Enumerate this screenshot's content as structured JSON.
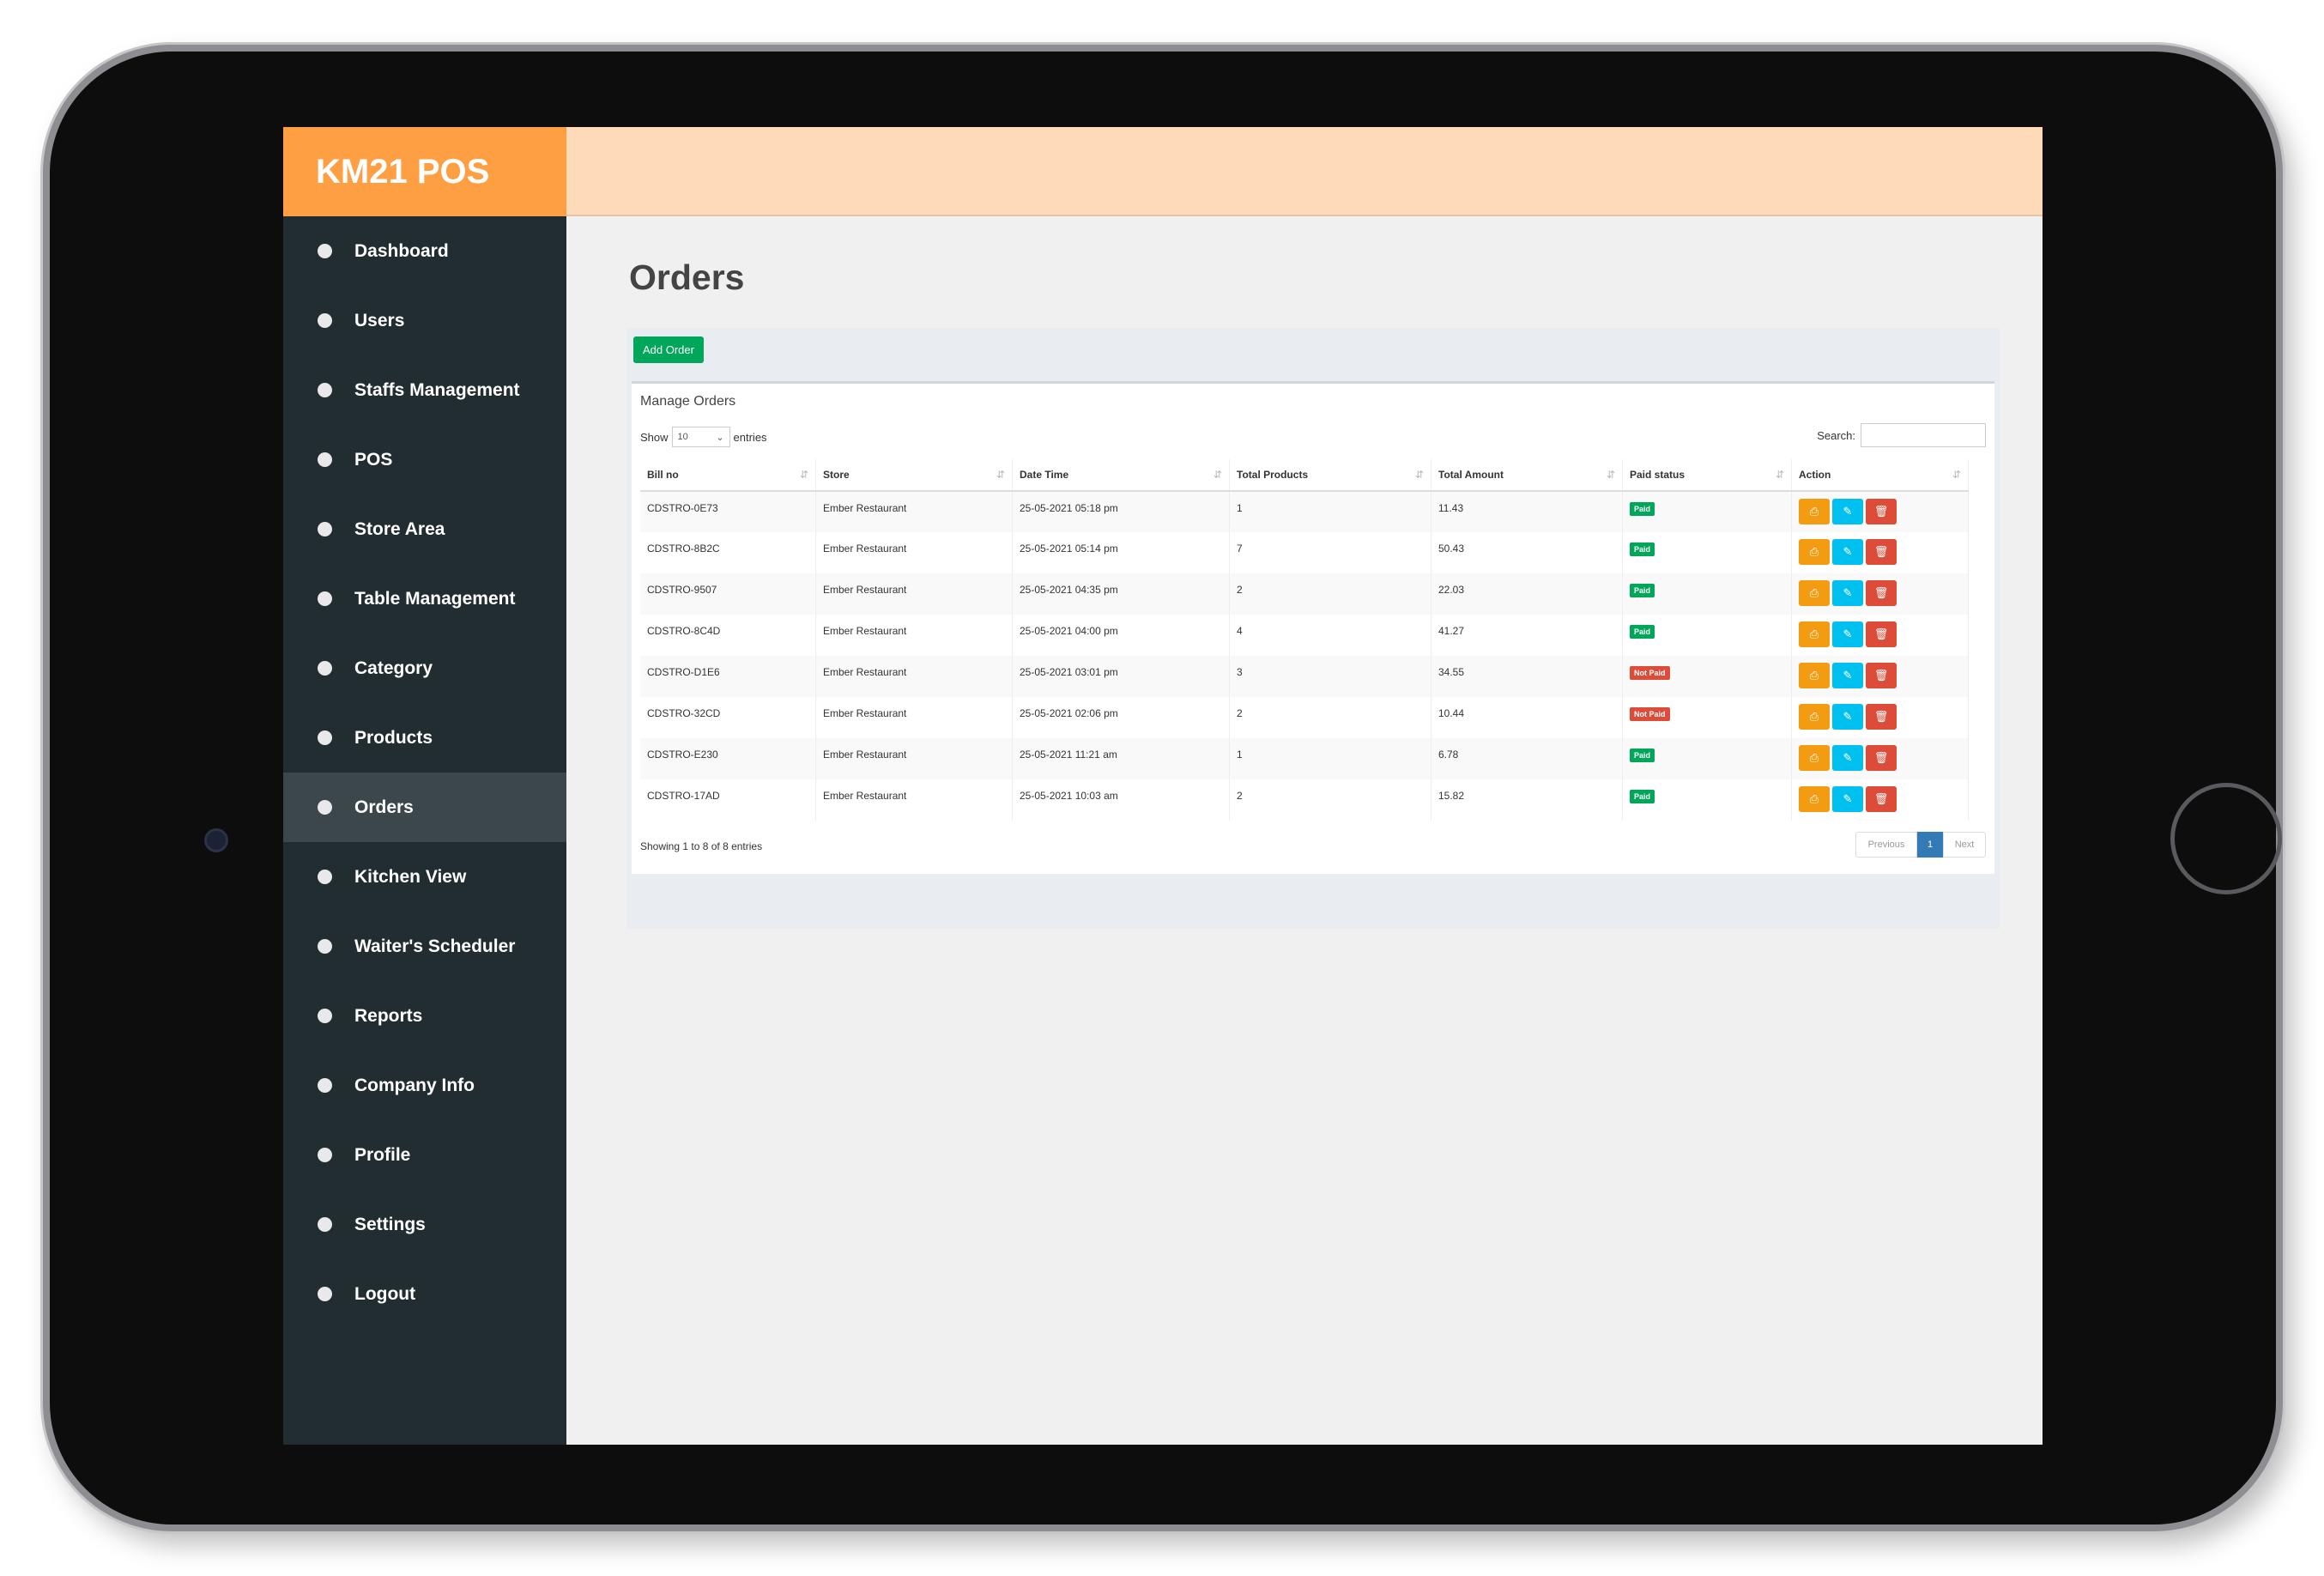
{
  "brand": {
    "title": "KM21 POS"
  },
  "sidebar": {
    "items": [
      {
        "label": "Dashboard"
      },
      {
        "label": "Users"
      },
      {
        "label": "Staffs Management"
      },
      {
        "label": "POS"
      },
      {
        "label": "Store Area"
      },
      {
        "label": "Table Management"
      },
      {
        "label": "Category"
      },
      {
        "label": "Products"
      },
      {
        "label": "Orders",
        "active": true
      },
      {
        "label": "Kitchen View"
      },
      {
        "label": "Waiter's Scheduler"
      },
      {
        "label": "Reports"
      },
      {
        "label": "Company Info"
      },
      {
        "label": "Profile"
      },
      {
        "label": "Settings"
      },
      {
        "label": "Logout"
      }
    ]
  },
  "page": {
    "title": "Orders",
    "add_button": "Add Order",
    "card_title": "Manage Orders",
    "show_label": "Show",
    "entries_label": "entries",
    "page_length": "10",
    "search_label": "Search:",
    "info": "Showing 1 to 8 of 8 entries"
  },
  "table": {
    "columns": [
      "Bill no",
      "Store",
      "Date Time",
      "Total Products",
      "Total Amount",
      "Paid status",
      "Action"
    ],
    "rows": [
      {
        "bill": "CDSTRO-0E73",
        "store": "Ember Restaurant",
        "datetime": "25-05-2021 05:18 pm",
        "products": "1",
        "amount": "11.43",
        "status": "Paid"
      },
      {
        "bill": "CDSTRO-8B2C",
        "store": "Ember Restaurant",
        "datetime": "25-05-2021 05:14 pm",
        "products": "7",
        "amount": "50.43",
        "status": "Paid"
      },
      {
        "bill": "CDSTRO-9507",
        "store": "Ember Restaurant",
        "datetime": "25-05-2021 04:35 pm",
        "products": "2",
        "amount": "22.03",
        "status": "Paid"
      },
      {
        "bill": "CDSTRO-8C4D",
        "store": "Ember Restaurant",
        "datetime": "25-05-2021 04:00 pm",
        "products": "4",
        "amount": "41.27",
        "status": "Paid"
      },
      {
        "bill": "CDSTRO-D1E6",
        "store": "Ember Restaurant",
        "datetime": "25-05-2021 03:01 pm",
        "products": "3",
        "amount": "34.55",
        "status": "Not Paid"
      },
      {
        "bill": "CDSTRO-32CD",
        "store": "Ember Restaurant",
        "datetime": "25-05-2021 02:06 pm",
        "products": "2",
        "amount": "10.44",
        "status": "Not Paid"
      },
      {
        "bill": "CDSTRO-E230",
        "store": "Ember Restaurant",
        "datetime": "25-05-2021 11:21 am",
        "products": "1",
        "amount": "6.78",
        "status": "Paid"
      },
      {
        "bill": "CDSTRO-17AD",
        "store": "Ember Restaurant",
        "datetime": "25-05-2021 10:03 am",
        "products": "2",
        "amount": "15.82",
        "status": "Paid"
      }
    ]
  },
  "pagination": {
    "previous": "Previous",
    "current": "1",
    "next": "Next"
  },
  "colors": {
    "brand": "#ff9f43",
    "topbar": "#ffdab9",
    "sidebar": "#222d32",
    "paid": "#00a65a",
    "not_paid": "#dd4b39",
    "print": "#f39c12",
    "edit": "#00c0ef"
  },
  "icons": {
    "print": "print-icon",
    "edit": "pencil-icon",
    "delete": "trash-icon",
    "sort": "sort-icon",
    "select": "chevron-down-icon"
  }
}
